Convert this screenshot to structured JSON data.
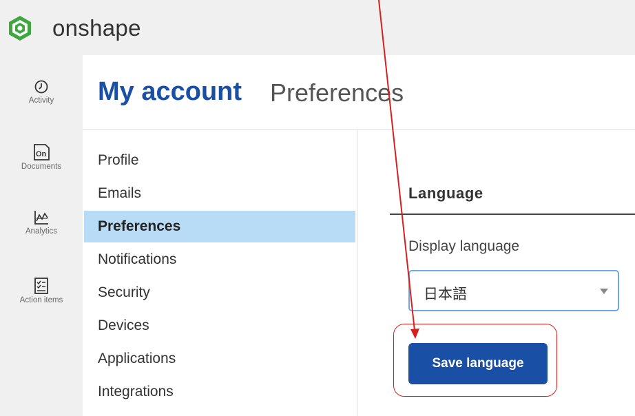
{
  "app": {
    "brand": "onshape",
    "accent_color": "#1a4fa6",
    "highlight_color": "#d62020"
  },
  "rail": {
    "items": [
      {
        "label": "Activity",
        "icon": "clock-icon"
      },
      {
        "label": "Documents",
        "icon": "document-icon"
      },
      {
        "label": "Analytics",
        "icon": "chart-icon"
      },
      {
        "label": "Action items",
        "icon": "checklist-icon"
      }
    ]
  },
  "header": {
    "title": "My account",
    "subtitle": "Preferences"
  },
  "sidenav": {
    "items": [
      {
        "label": "Profile",
        "active": false
      },
      {
        "label": "Emails",
        "active": false
      },
      {
        "label": "Preferences",
        "active": true
      },
      {
        "label": "Notifications",
        "active": false
      },
      {
        "label": "Security",
        "active": false
      },
      {
        "label": "Devices",
        "active": false
      },
      {
        "label": "Applications",
        "active": false
      },
      {
        "label": "Integrations",
        "active": false
      }
    ]
  },
  "language": {
    "section_title": "Language",
    "field_label": "Display language",
    "selected_value": "日本語",
    "save_label": "Save language"
  }
}
